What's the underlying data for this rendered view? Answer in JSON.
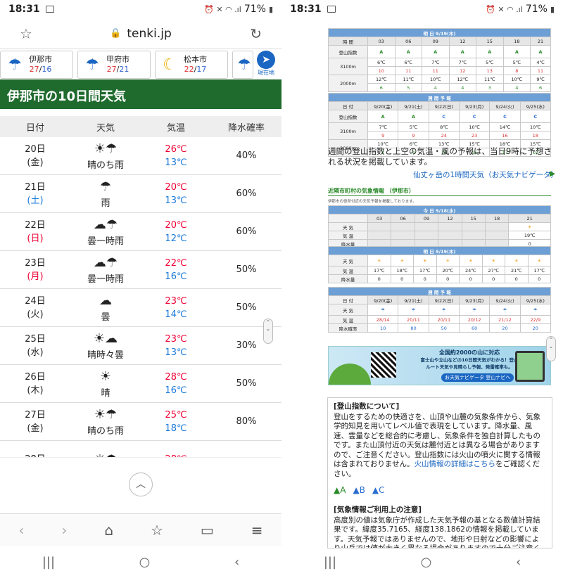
{
  "status": {
    "time": "18:31",
    "battery": "71%"
  },
  "browser": {
    "url": "tenki.jp"
  },
  "cities": [
    {
      "name": "伊那市",
      "hi": "27",
      "lo": "16"
    },
    {
      "name": "甲府市",
      "hi": "27",
      "lo": "21"
    },
    {
      "name": "松本市",
      "hi": "22",
      "lo": "17"
    }
  ],
  "location_label": "現在地",
  "title": "伊那市の10日間天気",
  "table": {
    "headers": [
      "日付",
      "天気",
      "気温",
      "降水確率"
    ],
    "rows": [
      {
        "day": "20日",
        "dow": "(金)",
        "dow_class": "",
        "weather": "晴のち雨",
        "icon": "☀☂",
        "hi": "26℃",
        "lo": "13℃",
        "pop": "40%"
      },
      {
        "day": "21日",
        "dow": "(土)",
        "dow_class": "sat",
        "weather": "雨",
        "icon": "☂",
        "hi": "20℃",
        "lo": "13℃",
        "pop": "60%"
      },
      {
        "day": "22日",
        "dow": "(日)",
        "dow_class": "sun",
        "weather": "曇一時雨",
        "icon": "☁☂",
        "hi": "20℃",
        "lo": "12℃",
        "pop": "60%"
      },
      {
        "day": "23日",
        "dow": "(月)",
        "dow_class": "sun",
        "weather": "曇一時雨",
        "icon": "☁☂",
        "hi": "22℃",
        "lo": "16℃",
        "pop": "50%"
      },
      {
        "day": "24日",
        "dow": "(火)",
        "dow_class": "",
        "weather": "曇",
        "icon": "☁",
        "hi": "23℃",
        "lo": "14℃",
        "pop": "50%"
      },
      {
        "day": "25日",
        "dow": "(水)",
        "dow_class": "",
        "weather": "晴時々曇",
        "icon": "☀☁",
        "hi": "23℃",
        "lo": "13℃",
        "pop": "30%"
      },
      {
        "day": "26日",
        "dow": "(木)",
        "dow_class": "",
        "weather": "晴",
        "icon": "☀",
        "hi": "28℃",
        "lo": "16℃",
        "pop": "50%"
      },
      {
        "day": "27日",
        "dow": "(金)",
        "dow_class": "",
        "weather": "晴のち雨",
        "icon": "☀☂",
        "hi": "25℃",
        "lo": "18℃",
        "pop": "80%"
      },
      {
        "day": "28日",
        "dow": "",
        "dow_class": "",
        "weather": "",
        "icon": "☀☂",
        "hi": "28℃",
        "lo": "",
        "pop": ""
      }
    ]
  },
  "right": {
    "mountain_tomorrow": {
      "header": "明 日 9/19(木)",
      "hours": [
        "時 間",
        "03",
        "06",
        "09",
        "12",
        "15",
        "18",
        "21"
      ],
      "index_label": "登山指数",
      "idx": [
        "A",
        "A",
        "A",
        "A",
        "A",
        "A",
        "A"
      ],
      "t3100": [
        "6℃",
        "6℃",
        "7℃",
        "7℃",
        "5℃",
        "5℃",
        "4℃"
      ],
      "w3100": [
        "10",
        "11",
        "11",
        "12",
        "13",
        "8",
        "11"
      ],
      "t2000": [
        "12℃",
        "11℃",
        "10℃",
        "12℃",
        "11℃",
        "10℃",
        "9℃"
      ],
      "w2000": [
        "6",
        "5",
        "4",
        "4",
        "3",
        "4",
        "6"
      ]
    },
    "mountain_week": {
      "header": "週 間 予 報",
      "dates": [
        "日 付",
        "9/20(金)",
        "9/21(土)",
        "9/22(日)",
        "9/23(月)",
        "9/24(火)",
        "9/25(水)"
      ],
      "idx": [
        "A",
        "A",
        "C",
        "C",
        "C",
        "C"
      ],
      "t3100": [
        "7℃",
        "5℃",
        "8℃",
        "10℃",
        "14℃",
        "10℃"
      ],
      "w3100": [
        "9",
        "9",
        "24",
        "23",
        "16",
        "18"
      ],
      "t2000": [
        "10℃",
        "6℃",
        "13℃",
        "15℃",
        "18℃",
        "15℃"
      ],
      "w2000": [
        "2",
        "4",
        "10",
        "16",
        "17",
        "10"
      ]
    },
    "note1": "週間の登山指数と上空の気温・風の予報は、当日9時に予想される状況を掲載しています。",
    "link1": "仙丈ヶ岳の1時間天気（お天気ナビゲータ）",
    "section": "近隣市町村の気象情報 （伊那市）",
    "section_note": "伊那市の役所付近の天気予報を掲載しております。",
    "today": {
      "header": "今 日 9/18(水)",
      "hours": [
        "03",
        "06",
        "09",
        "12",
        "15",
        "18",
        "21"
      ],
      "temp21": "19℃",
      "pop21": "0"
    },
    "tomorrow": {
      "header": "明 日 9/19(木)",
      "temps": [
        "17℃",
        "18℃",
        "17℃",
        "20℃",
        "24℃",
        "27℃",
        "21℃",
        "17℃"
      ],
      "pops": [
        "0",
        "0",
        "0",
        "0",
        "0",
        "0",
        "0",
        "0"
      ]
    },
    "week": {
      "header": "週 間 予 報",
      "dates": [
        "9/20(金)",
        "9/21(土)",
        "9/22(日)",
        "9/23(月)",
        "9/24(火)",
        "9/25(水)"
      ],
      "hilo": [
        "28/14",
        "20/11",
        "20/11",
        "20/12",
        "21/12",
        "22/9"
      ],
      "pop": [
        "10",
        "80",
        "50",
        "60",
        "20",
        "20"
      ]
    },
    "banner_top": "全国約2000の山に対応",
    "banner_main": "富士山や立山などの10日間天気がわかる！登山ルート天気や見晴らし予報、発雷確率も。",
    "banner_btn": "お天気ナビゲータ 登山ナビへ",
    "info_h1": "[登山指数について]",
    "info_p1": "登山をするための快適さを、山頂や山麓の気象条件から、気象学的知見を用いてレベル値で表現をしています。降水量、風速、雲量などを総合的に考慮し、気象条件を独自計算したものです。また山頂付近の天気は麓付近とは異なる場合がありますので、ご注意ください。登山指数には火山の噴火に関する情報は含まれておりません。",
    "info_link": "火山情報の詳細はこちら",
    "info_p1b": "をご確認ください。",
    "info_h2": "[気象情報ご利用上の注意]",
    "info_p2": "高度別の値は気象庁が作成した天気予報の基となる数値計算結果です。緯度35.7165、経度138.1862の情報を掲載しています。天気予報ではありませんので、地形や日射などの影響により山岳では値が大きく異なる場合がありますので十分ご注意ください。"
  }
}
